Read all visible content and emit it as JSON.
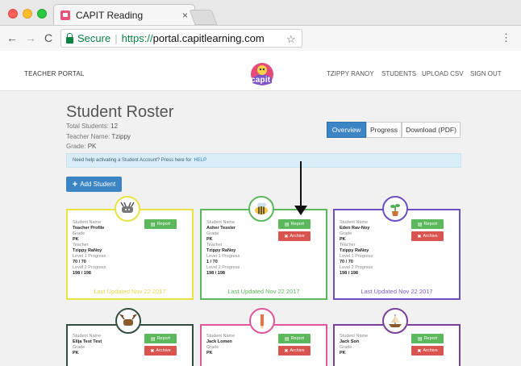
{
  "browser": {
    "tab_title": "CAPIT Reading",
    "tab_close": "×",
    "back": "←",
    "forward": "→",
    "reload": "C",
    "secure_label": "Secure",
    "url_scheme": "https://",
    "url_rest": "portal.capitlearning.com",
    "star": "☆",
    "menu": "⋮"
  },
  "header": {
    "portal_label": "TEACHER PORTAL",
    "logo_text": "capit",
    "nav": [
      "TZIPPY RANOY",
      "STUDENTS",
      "UPLOAD CSV",
      "SIGN OUT"
    ]
  },
  "roster": {
    "title": "Student Roster",
    "total_label": "Total Students:",
    "total_value": "12",
    "teacher_label": "Teacher Name:",
    "teacher_value": "Tzippy",
    "grade_label": "Grade:",
    "grade_value": "PK",
    "tabs": [
      "Overview",
      "Progress",
      "Download (PDF)"
    ],
    "help_text": "Need help activating a Student Account? Press here for",
    "help_link": "HELP",
    "add_button": "Add Student"
  },
  "labels": {
    "student_name": "Student Name",
    "grade": "Grade",
    "teacher": "Teacher",
    "level1": "Level 1 Progress",
    "level2": "Level 2 Progress",
    "report": "Report",
    "archive": "Archive"
  },
  "cards": [
    {
      "name": "Teacher Profile",
      "grade": "PK",
      "teacher": "Tzippy RaNoy",
      "level1": "70 / 70",
      "level2": "198 / 198",
      "updated": "Last Updated Nov 22 2017",
      "border": "#e9e245",
      "avatar": "moose-icon"
    },
    {
      "name": "Asher Tessler",
      "grade": "PK",
      "teacher": "Tzippy RaNoy",
      "level1": "1 / 70",
      "level2": "198 / 198",
      "updated": "Last Updated Nov 22 2017",
      "border": "#5cb85c",
      "avatar": "bee-icon"
    },
    {
      "name": "Eden Rav-Noy",
      "grade": "PK",
      "teacher": "Tzippy RaNoy",
      "level1": "70 / 70",
      "level2": "198 / 198",
      "updated": "Last Updated Nov 22 2017",
      "border": "#6c4fc1",
      "avatar": "plant-icon"
    },
    {
      "name": "Elija Test Test",
      "grade": "Grade",
      "grade_value": "PK",
      "border": "#2f4f3f",
      "avatar": "moose-icon"
    },
    {
      "name": "Jack Lomen",
      "grade": "Grade",
      "grade_value": "PK",
      "border": "#e0569a",
      "avatar": "pencil-icon"
    },
    {
      "name": "Jack Son",
      "grade": "Grade",
      "grade_value": "PK",
      "border": "#7a3f99",
      "avatar": "ship-icon"
    }
  ],
  "colors": {
    "primary": "#3b85c5",
    "report": "#5cb85c",
    "archive": "#d9534f"
  }
}
